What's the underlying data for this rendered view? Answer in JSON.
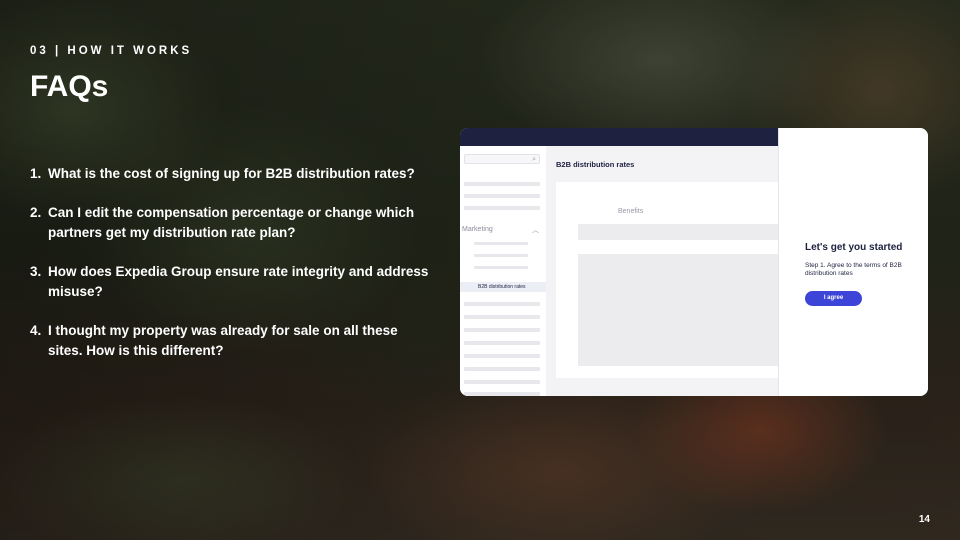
{
  "slide": {
    "eyebrow": "03 | HOW IT WORKS",
    "title": "FAQs",
    "page_number": "14"
  },
  "faqs": [
    {
      "number": "1.",
      "text": "What is the cost of signing up for B2B distribution rates?"
    },
    {
      "number": "2.",
      "text": "Can I edit the compensation percentage or change which partners get my distribution rate plan?"
    },
    {
      "number": "3.",
      "text": "How does Expedia Group ensure rate integrity and address misuse?"
    },
    {
      "number": "4.",
      "text": "I thought my property was already for sale on all these sites. How is this different?"
    }
  ],
  "mockup": {
    "sidebar": {
      "section_label": "Marketing",
      "active_item": "B2B distribution rates"
    },
    "main": {
      "title": "B2B distribution rates",
      "card_label": "Benefits"
    },
    "panel": {
      "heading": "Let's get you started",
      "step_text": "Step 1. Agree to the terms of B2B distribution rates",
      "button_label": "I agree"
    },
    "colors": {
      "nav": "#1e2140",
      "button": "#3d44d8"
    }
  }
}
